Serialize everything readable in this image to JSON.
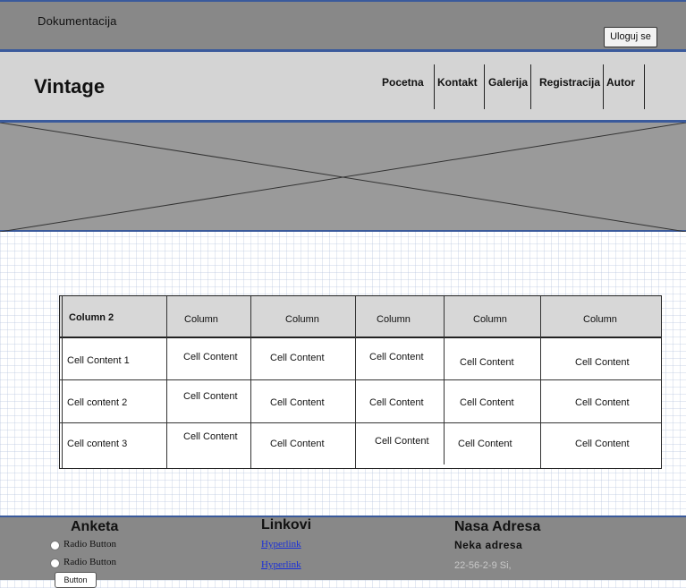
{
  "topbar": {
    "title": "Dokumentacija",
    "login_label": "Uloguj se"
  },
  "header": {
    "brand": "Vintage",
    "nav": [
      "Pocetna",
      "Kontakt",
      "Galerija",
      "Registracija",
      "Autor"
    ]
  },
  "hero": {
    "image": "image-placeholder"
  },
  "table": {
    "columns": [
      "Column 2",
      "Column",
      "Column",
      "Column",
      "Column",
      "Column"
    ],
    "rows": [
      [
        "Cell Content 1",
        "Cell Content",
        "Cell Content",
        "Cell Content",
        "Cell Content",
        "Cell Content"
      ],
      [
        "Cell content 2",
        "Cell Content",
        "Cell Content",
        "Cell Content",
        "Cell Content",
        "Cell Content"
      ],
      [
        "Cell content 3",
        "Cell Content",
        "Cell Content",
        "Cell Content",
        "Cell Content",
        "Cell Content"
      ]
    ]
  },
  "footer": {
    "poll": {
      "heading": "Anketa",
      "options": [
        "Radio Button",
        "Radio Button"
      ],
      "button_label": "Button"
    },
    "links": {
      "heading": "Linkovi",
      "items": [
        "Hyperlink",
        "Hyperlink"
      ]
    },
    "address": {
      "heading": "Nasa Adresa",
      "line1": "Neka adresa",
      "line2": "22-56-2-9 Si,"
    }
  },
  "colors": {
    "accent": "#3a5a9c",
    "bar": "#888888",
    "header": "#d4d4d4",
    "hero": "#9a9a9a",
    "link": "#1a2fd8"
  }
}
